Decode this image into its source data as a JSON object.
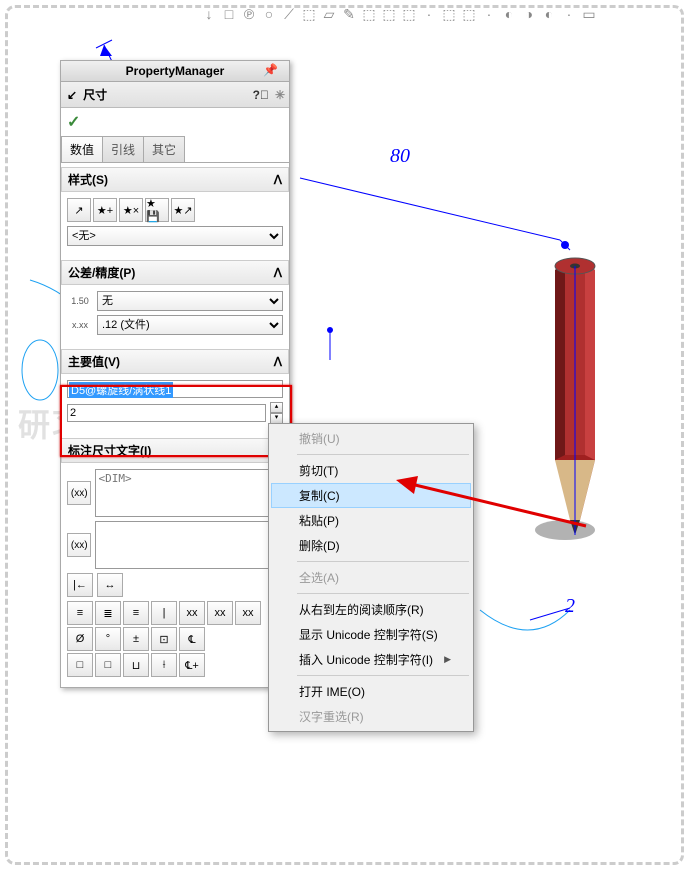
{
  "toolbar_icons": [
    "↓",
    "□",
    "℗",
    "○",
    "⟋",
    "⬚",
    "▱",
    "✎",
    "⬚",
    "⬚",
    "⬚",
    "·",
    "⬚",
    "⬚",
    "·",
    "◐",
    "◑",
    "◐",
    "·",
    "▭"
  ],
  "panel": {
    "title": "PropertyManager",
    "dim_title": "尺寸",
    "tabs": [
      "数值",
      "引线",
      "其它"
    ],
    "style": {
      "label": "样式(S)",
      "dropdown": "<无>",
      "icons": [
        "↗",
        "★+",
        "★×",
        "★💾",
        "★↗"
      ]
    },
    "tolerance": {
      "label": "公差/精度(P)",
      "row1_icon": "1.50",
      "row1_value": "无",
      "row2_icon": "x.xx",
      "row2_value": ".12 (文件)"
    },
    "primary": {
      "label": "主要值(V)",
      "name": "D5@螺旋线/涡状线1",
      "value": "2"
    },
    "dimtext": {
      "label": "标注尺寸文字(I)",
      "placeholder": "<DIM>",
      "icon1": "(xx)",
      "icon2": "(xx)",
      "small_icons": [
        "|←",
        "↔"
      ],
      "row1": [
        "≡",
        "≣",
        "≡",
        "|",
        "xx",
        "xx",
        "xx"
      ],
      "row2": [
        "Ø",
        "°",
        "±",
        "⊡",
        "℄"
      ],
      "row3": [
        "□",
        "□",
        "⊔",
        "⟊",
        "℄+"
      ]
    }
  },
  "context_menu": {
    "items": [
      {
        "label": "撤销(U)",
        "disabled": true
      },
      {
        "sep": true
      },
      {
        "label": "剪切(T)"
      },
      {
        "label": "复制(C)",
        "highlight": true
      },
      {
        "label": "粘贴(P)"
      },
      {
        "label": "删除(D)"
      },
      {
        "sep": true
      },
      {
        "label": "全选(A)",
        "disabled": true
      },
      {
        "sep": true
      },
      {
        "label": "从右到左的阅读顺序(R)"
      },
      {
        "label": "显示 Unicode 控制字符(S)"
      },
      {
        "label": "插入 Unicode 控制字符(I)",
        "submenu": true
      },
      {
        "sep": true
      },
      {
        "label": "打开 IME(O)"
      },
      {
        "label": "汉字重选(R)",
        "disabled": true
      }
    ]
  },
  "dims": {
    "d80": "80",
    "d2": "2"
  },
  "watermark": "研习社"
}
